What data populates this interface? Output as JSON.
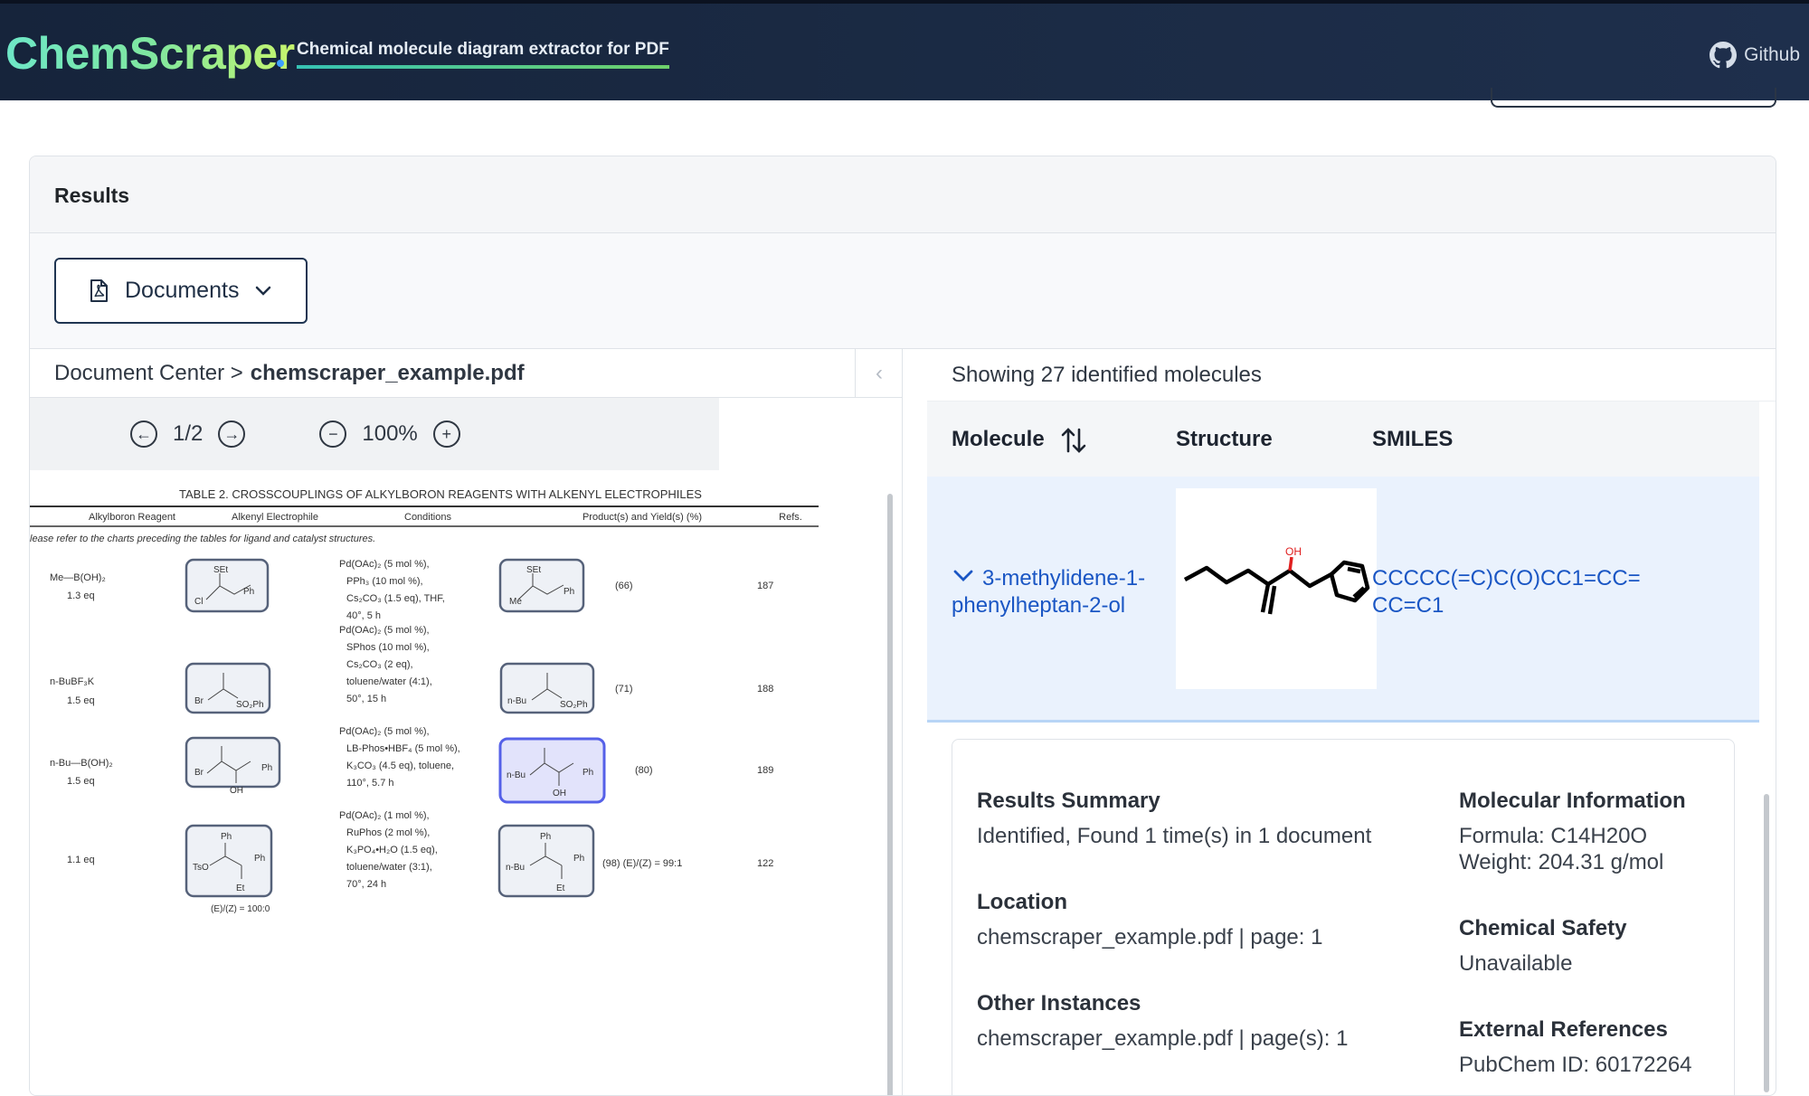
{
  "header": {
    "logo": "ChemScraper",
    "tagline": "Chemical molecule diagram extractor for PDF",
    "github_label": "Github"
  },
  "results": {
    "title": "Results",
    "documents_button": "Documents"
  },
  "document": {
    "breadcrumb_root": "Document Center >",
    "file_name": "chemscraper_example.pdf",
    "page_indicator": "1/2",
    "zoom_level": "100%"
  },
  "pdf_table": {
    "title": "TABLE 2. CROSSCOUPLINGS OF ALKYLBORON REAGENTS WITH ALKENYL ELECTROPHILES",
    "headers": [
      "Alkylboron Reagent",
      "Alkenyl Electrophile",
      "Conditions",
      "Product(s) and Yield(s) (%)",
      "Refs."
    ],
    "note": "lease refer to the charts preceding the tables for ligand and catalyst structures.",
    "rows": [
      {
        "reagent": "Me—B(OH)₂",
        "eq": "1.3 eq",
        "conditions": [
          "Pd(OAc)₂ (5 mol %),",
          "PPh₃ (10 mol %),",
          "Cs₂CO₃ (1.5 eq), THF,",
          "40°, 5 h"
        ],
        "yield": "(66)",
        "ref": "187"
      },
      {
        "reagent": "n-BuBF₃K",
        "eq": "1.5 eq",
        "conditions": [
          "Pd(OAc)₂ (5 mol %),",
          "SPhos (10 mol %),",
          "Cs₂CO₃ (2 eq),",
          "toluene/water (4:1),",
          "50°, 15 h"
        ],
        "yield": "(71)",
        "ref": "188"
      },
      {
        "reagent": "n-Bu—B(OH)₂",
        "eq": "1.5 eq",
        "conditions": [
          "Pd(OAc)₂ (5 mol %),",
          "LB-Phos•HBF₄ (5 mol %),",
          "K₃CO₃ (4.5 eq), toluene,",
          "110°, 5.7 h"
        ],
        "yield": "(80)",
        "ref": "189"
      },
      {
        "reagent": "",
        "eq": "1.1 eq",
        "conditions": [
          "Pd(OAc)₂ (1 mol %),",
          "RuPhos (2 mol %),",
          "K₃PO₄•H₂O (1.5 eq),",
          "toluene/water (3:1),",
          "70°, 24 h"
        ],
        "yield": "(98)  (E)/(Z) = 99:1",
        "ref": "122"
      }
    ],
    "footnote": "(E)/(Z) = 100:0"
  },
  "molecules": {
    "showing_text": "Showing 27 identified molecules",
    "columns": {
      "molecule": "Molecule",
      "structure": "Structure",
      "smiles": "SMILES"
    },
    "selected": {
      "name": "3-methylidene-1-phenylheptan-2-ol",
      "smiles": "CCCCC(=C)C(O)CC1=CC=CC=C1",
      "oh_label": "OH"
    }
  },
  "details": {
    "summary_label": "Results Summary",
    "summary_value": "Identified, Found 1 time(s) in 1 document",
    "location_label": "Location",
    "location_value": "chemscraper_example.pdf | page: 1",
    "instances_label": "Other Instances",
    "instances_value": "chemscraper_example.pdf | page(s): 1",
    "molinfo_label": "Molecular Information",
    "formula": "Formula: C14H20O",
    "weight": "Weight: 204.31 g/mol",
    "safety_label": "Chemical Safety",
    "safety_value": "Unavailable",
    "refs_label": "External References",
    "pubchem": "PubChem ID: 60172264"
  },
  "colors": {
    "header_bg": "#16243b",
    "accent_link": "#1a56c4",
    "selected_row": "#eaf2fd",
    "highlight_box": "#5560e8"
  }
}
